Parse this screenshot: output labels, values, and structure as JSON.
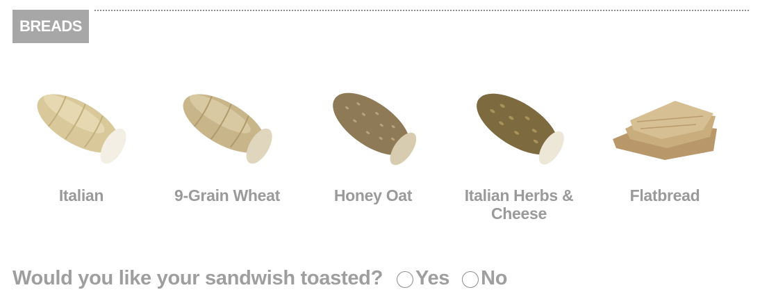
{
  "section": {
    "title": "BREADS"
  },
  "breads": [
    {
      "label": "Italian",
      "icon": "italian-bread-image"
    },
    {
      "label": "9-Grain Wheat",
      "icon": "nine-grain-wheat-bread-image"
    },
    {
      "label": "Honey Oat",
      "icon": "honey-oat-bread-image"
    },
    {
      "label": "Italian Herbs &\nCheese",
      "icon": "italian-herbs-cheese-bread-image"
    },
    {
      "label": "Flatbread",
      "icon": "flatbread-image"
    }
  ],
  "toast": {
    "question": "Would you like your sandwish toasted?",
    "options": [
      {
        "label": "Yes"
      },
      {
        "label": "No"
      }
    ]
  },
  "colors": {
    "badge_bg": "#a7a7a7",
    "label_text": "#9a9a9a",
    "italian": "#d8c89a",
    "wheat": "#c9b58a",
    "honey_oat": "#8f7a57",
    "herbs": "#7d6a3f",
    "flatbread": "#c9ad7c"
  }
}
